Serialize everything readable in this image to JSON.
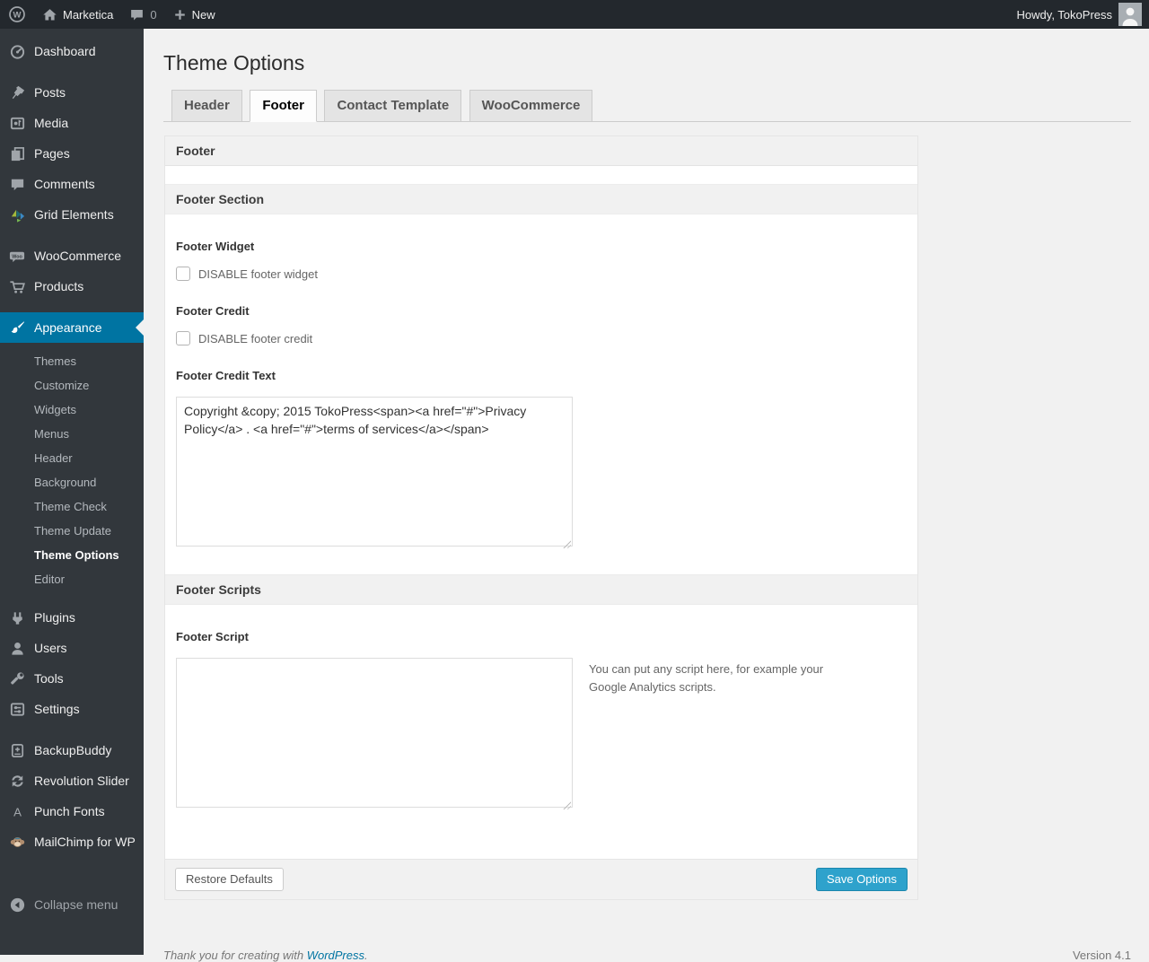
{
  "admin_bar": {
    "site_name": "Marketica",
    "comments_count": "0",
    "new_label": "New",
    "howdy": "Howdy, TokoPress"
  },
  "tabs": [
    {
      "label": "Header",
      "active": false
    },
    {
      "label": "Footer",
      "active": true
    },
    {
      "label": "Contact Template",
      "active": false
    },
    {
      "label": "WooCommerce",
      "active": false
    }
  ],
  "page": {
    "title": "Theme Options"
  },
  "content": {
    "panel_title": "Footer",
    "section_title": "Footer Section",
    "footer_widget_label": "Footer Widget",
    "footer_widget_checkbox": "DISABLE footer widget",
    "footer_credit_label": "Footer Credit",
    "footer_credit_checkbox": "DISABLE footer credit",
    "footer_credit_text_label": "Footer Credit Text",
    "footer_credit_text_value": "Copyright &copy; 2015 TokoPress<span><a href=\"#\">Privacy Policy</a> . <a href=\"#\">terms of services</a></span>",
    "scripts_section_title": "Footer Scripts",
    "footer_script_label": "Footer Script",
    "footer_script_value": "",
    "footer_script_hint": "You can put any script here, for example your Google Analytics scripts.",
    "restore_button": "Restore Defaults",
    "save_button": "Save Options"
  },
  "sidebar": {
    "items": [
      {
        "label": "Dashboard",
        "icon": "dashboard-icon"
      },
      {
        "label": "Posts",
        "icon": "pushpin-icon"
      },
      {
        "label": "Media",
        "icon": "media-icon"
      },
      {
        "label": "Pages",
        "icon": "pages-icon"
      },
      {
        "label": "Comments",
        "icon": "comment-icon"
      },
      {
        "label": "Grid Elements",
        "icon": "grid-elements-icon"
      },
      {
        "label": "WooCommerce",
        "icon": "woocommerce-icon"
      },
      {
        "label": "Products",
        "icon": "cart-icon"
      },
      {
        "label": "Appearance",
        "icon": "brush-icon",
        "active": true
      },
      {
        "label": "Plugins",
        "icon": "plugin-icon"
      },
      {
        "label": "Users",
        "icon": "user-icon"
      },
      {
        "label": "Tools",
        "icon": "wrench-icon"
      },
      {
        "label": "Settings",
        "icon": "settings-icon"
      },
      {
        "label": "BackupBuddy",
        "icon": "backup-icon"
      },
      {
        "label": "Revolution Slider",
        "icon": "refresh-icon"
      },
      {
        "label": "Punch Fonts",
        "icon": "letter-a-icon"
      },
      {
        "label": "MailChimp for WP",
        "icon": "monkey-icon"
      },
      {
        "label": "Collapse menu",
        "icon": "collapse-icon"
      }
    ],
    "appearance_submenu": [
      "Themes",
      "Customize",
      "Widgets",
      "Menus",
      "Header",
      "Background",
      "Theme Check",
      "Theme Update",
      "Theme Options",
      "Editor"
    ],
    "current_submenu_item": "Theme Options"
  },
  "footer": {
    "thanks_prefix": "Thank you for creating with",
    "wordpress_link": "WordPress",
    "thanks_suffix": ".",
    "version": "Version 4.1"
  },
  "colors": {
    "accent": "#0074a2",
    "primary_button": "#2ea2cc",
    "admin_bar_bg": "#23282d",
    "sidebar_bg": "#32373c"
  }
}
